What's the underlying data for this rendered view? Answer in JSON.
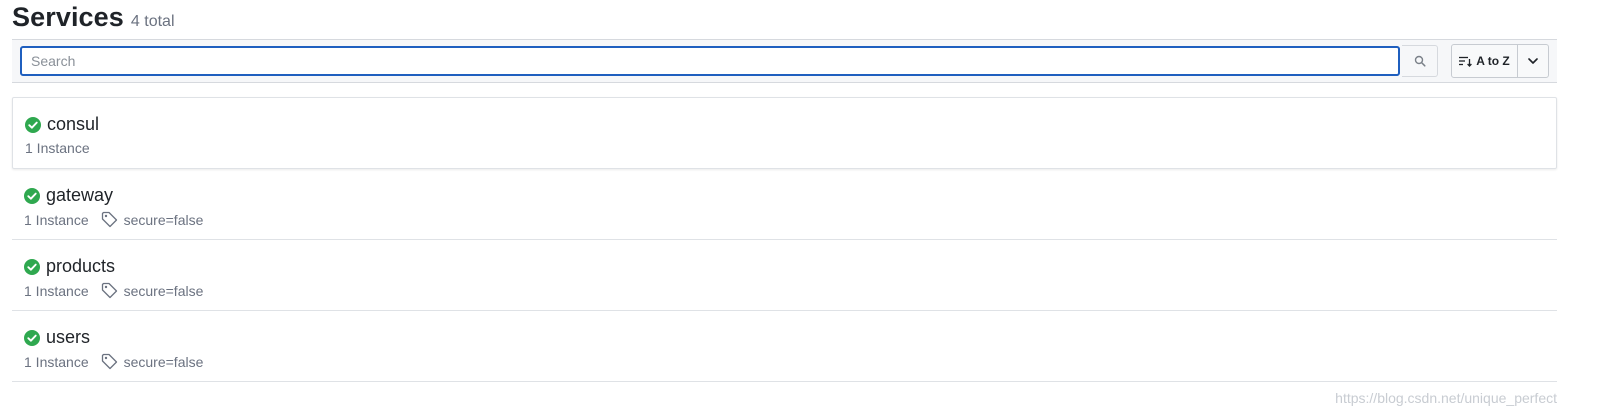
{
  "header": {
    "title": "Services",
    "count": "4 total"
  },
  "toolbar": {
    "search_placeholder": "Search",
    "sort_label": "A to Z",
    "search_icon": "search-icon",
    "sort_icon": "sort-icon",
    "caret_icon": "chevron-down-icon"
  },
  "colors": {
    "accent": "#1f5fbf",
    "passing": "#2fa84f",
    "muted": "#6b7280"
  },
  "services": [
    {
      "name": "consul",
      "instances": "1 Instance",
      "tag": "",
      "status": "passing"
    },
    {
      "name": "gateway",
      "instances": "1 Instance",
      "tag": "secure=false",
      "status": "passing"
    },
    {
      "name": "products",
      "instances": "1 Instance",
      "tag": "secure=false",
      "status": "passing"
    },
    {
      "name": "users",
      "instances": "1 Instance",
      "tag": "secure=false",
      "status": "passing"
    }
  ],
  "watermark": "https://blog.csdn.net/unique_perfect"
}
